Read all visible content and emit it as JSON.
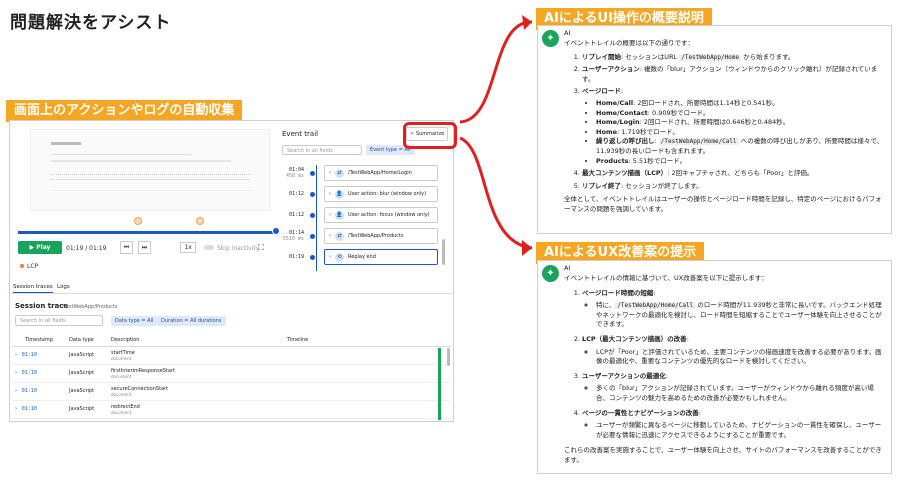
{
  "page_title": "問題解決をアシスト",
  "callouts": {
    "left": "画面上のアクションやログの自動収集",
    "right_top": "AIによるUI操作の概要説明",
    "right_bottom": "AIによるUX改善案の提示"
  },
  "colors": {
    "callout": "#f5a623",
    "highlight": "#e02020",
    "play": "#1aa35b"
  },
  "player": {
    "play_label": "Play",
    "time": "01:19 / 01:19",
    "speed": "1x",
    "skip_label": "Skip inactivity",
    "lcp_label": "LCP"
  },
  "event_trail": {
    "title": "Event trail",
    "summarize_label": "Summarize",
    "search_placeholder": "Search in all fields",
    "filter_chip": "Event type = All",
    "events": [
      {
        "time": "01:04",
        "sub": "458 ms",
        "label": "/TestWebApp/Home/Login",
        "icon": "navigation-icon"
      },
      {
        "time": "01:12",
        "sub": "",
        "label": "User action: blur (window only)",
        "icon": "user-icon"
      },
      {
        "time": "01:12",
        "sub": "",
        "label": "User action: focus (window only)",
        "icon": "user-icon"
      },
      {
        "time": "01:14",
        "sub": "5510 ms",
        "label": "/TestWebApp/Products",
        "icon": "navigation-icon"
      },
      {
        "time": "01:19",
        "sub": "",
        "label": "Replay end",
        "icon": "replay-icon"
      }
    ]
  },
  "tabs": [
    "Session traces",
    "Logs"
  ],
  "session_trace": {
    "title": "Session trace",
    "path": "/TestWebApp/Products",
    "search_placeholder": "Search in all fields",
    "chip_type": "Data type = All",
    "chip_duration": "Duration = All durations",
    "columns": [
      "Timestamp",
      "Data type",
      "Description",
      "Timeline"
    ],
    "rows": [
      {
        "ts": "01:10",
        "type": "JavaScript",
        "desc": "startTime",
        "sub": "document"
      },
      {
        "ts": "01:10",
        "type": "JavaScript",
        "desc": "firstInterimResponseStart",
        "sub": "document"
      },
      {
        "ts": "01:10",
        "type": "JavaScript",
        "desc": "secureConnectionStart",
        "sub": "document"
      },
      {
        "ts": "01:10",
        "type": "JavaScript",
        "desc": "redirectEnd",
        "sub": "document"
      }
    ]
  },
  "ai_summary": {
    "name": "AI",
    "intro": "イベントトレイルの概要は以下の通りです：",
    "item1_bold": "リプレイ開始",
    "item1_a": ": セッションはURL ",
    "item1_code": "/TestWebApp/Home",
    "item1_b": " から始まります。",
    "item2_bold": "ユーザーアクション",
    "item2": ": 複数の「blur」アクション（ウィンドウからのクリック離れ）が記録されています。",
    "item3_bold": "ページロード",
    "item3": ":",
    "pl1_bold": "Home/Call",
    "pl1": ": 2回ロードされ、所要時間は1.14秒と0.541秒。",
    "pl2_bold": "Home/Contact",
    "pl2": ": 0.909秒でロード。",
    "pl3_bold": "Home/Login",
    "pl3": ": 2回ロードされ、所要時間は0.646秒と0.484秒。",
    "pl4_bold": "Home",
    "pl4": ": 1.719秒でロード。",
    "pl5_bold": "繰り返しの呼び出し",
    "pl5_a": ": ",
    "pl5_code": "/TestWebApp/Home/Call",
    "pl5_b": " への複数の呼び出しがあり、所要時間は様々で、11.939秒の長いロードも含まれます。",
    "pl6_bold": "Products",
    "pl6": ": 5.51秒でロード。",
    "item4_bold": "最大コンテンツ描画（LCP）",
    "item4": ": 2回キャプチャされ、どちらも「Poor」と評価。",
    "item5_bold": "リプレイ終了",
    "item5": ": セッションが終了します。",
    "outro": "全体として、イベントトレイルはユーザーの操作とページロード時間を記録し、特定のページにおけるパフォーマンスの問題を強調しています。"
  },
  "ai_ux": {
    "name": "AI",
    "intro": "イベントトレイルの情報に基づいて、UX改善案を以下に提示します：",
    "s1_title": "ページロード時間の短縮",
    "s1_a": "特に、",
    "s1_code": "/TestWebApp/Home/Call",
    "s1_b": " のロード時間が11.939秒と非常に長いです。バックエンド処理やネットワークの最適化を検討し、ロード時間を短縮することでユーザー体験を向上させることができます。",
    "s2_title": "LCP（最大コンテンツ描画）の改善",
    "s2": "LCPが「Poor」と評価されているため、主要コンテンツの描画速度を改善する必要があります。画像の最適化や、重要なコンテンツの優先的なロードを検討してください。",
    "s3_title": "ユーザーアクションの最適化",
    "s3": "多くの「blur」アクションが記録されています。ユーザーがウィンドウから離れる頻度が高い場合、コンテンツの魅力を高めるための改善が必要かもしれません。",
    "s4_title": "ページの一貫性とナビゲーションの改善",
    "s4": "ユーザーが頻繁に異なるページに移動しているため、ナビゲーションの一貫性を確保し、ユーザーが必要な情報に迅速にアクセスできるようにすることが重要です。",
    "outro": "これらの改善案を実施することで、ユーザー体験を向上させ、サイトのパフォーマンスを改善することができます。"
  }
}
